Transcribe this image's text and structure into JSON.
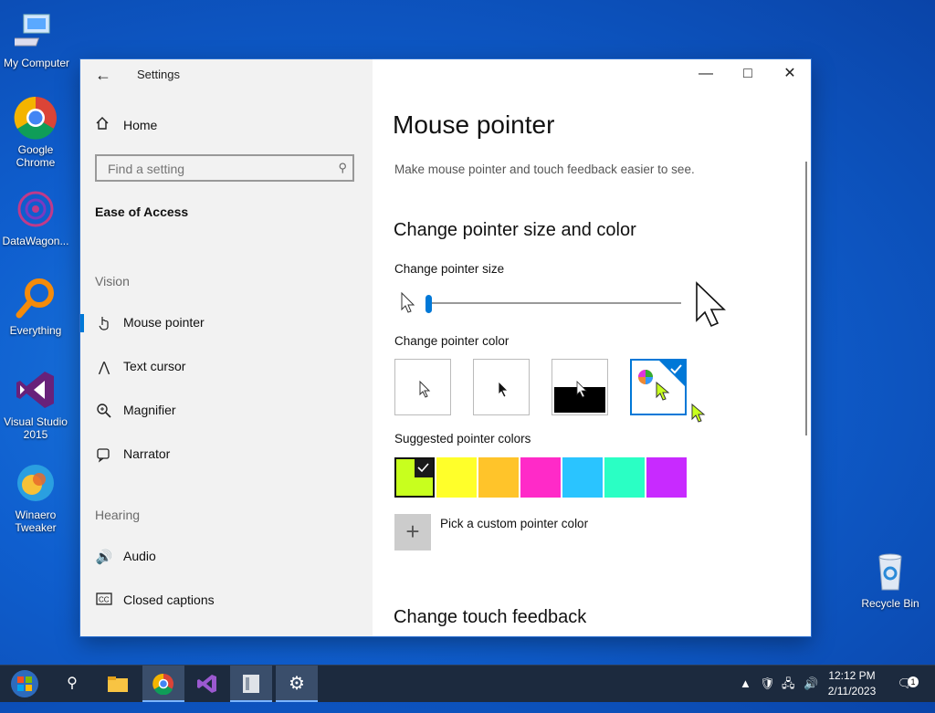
{
  "desktop": {
    "icons": [
      {
        "label": "My Computer",
        "icon": "computer-icon"
      },
      {
        "label": "Google Chrome",
        "icon": "chrome-icon"
      },
      {
        "label": "DataWagon...",
        "icon": "datawagon-icon"
      },
      {
        "label": "Everything",
        "icon": "everything-search-icon"
      },
      {
        "label": "Visual Studio 2015",
        "icon": "visual-studio-icon"
      },
      {
        "label": "Winaero Tweaker",
        "icon": "winaero-tweaker-icon"
      },
      {
        "label": "Recycle Bin",
        "icon": "recycle-bin-icon"
      }
    ]
  },
  "window": {
    "title": "Settings",
    "controls": {
      "minimize": "minimize-icon",
      "maximize": "maximize-icon",
      "close": "close-icon"
    }
  },
  "sidebar": {
    "home": "Home",
    "search_placeholder": "Find a setting",
    "category": "Ease of Access",
    "sections": {
      "vision": "Vision",
      "hearing": "Hearing"
    },
    "vision_items": [
      {
        "label": "Mouse pointer",
        "icon": "mouse-pointer-icon",
        "active": true
      },
      {
        "label": "Text cursor",
        "icon": "text-cursor-icon"
      },
      {
        "label": "Magnifier",
        "icon": "magnifier-icon"
      },
      {
        "label": "Narrator",
        "icon": "narrator-icon"
      }
    ],
    "hearing_items": [
      {
        "label": "Audio",
        "icon": "audio-icon"
      },
      {
        "label": "Closed captions",
        "icon": "closed-captions-icon"
      }
    ]
  },
  "content": {
    "title": "Mouse pointer",
    "description": "Make mouse pointer and touch feedback easier to see.",
    "section_size_color": "Change pointer size and color",
    "pointer_size_label": "Change pointer size",
    "pointer_size_value": 1,
    "pointer_color_label": "Change pointer color",
    "pointer_color_options": [
      "white",
      "black",
      "inverted",
      "custom"
    ],
    "pointer_color_selected": "custom",
    "suggested_label": "Suggested pointer colors",
    "suggested_colors": [
      "#c8ff1e",
      "#ffff2a",
      "#ffc42a",
      "#ff2ac8",
      "#2ac4ff",
      "#2affc4",
      "#c82aff"
    ],
    "suggested_selected": 0,
    "custom_color_label": "Pick a custom pointer color",
    "section_touch": "Change touch feedback"
  },
  "taskbar": {
    "time": "12:12 PM",
    "date": "2/11/2023",
    "notification_count": "1"
  },
  "colors": {
    "accent": "#0078d7",
    "sidebar_bg": "#f2f2f2",
    "taskbar_bg": "#1c2a3e"
  }
}
